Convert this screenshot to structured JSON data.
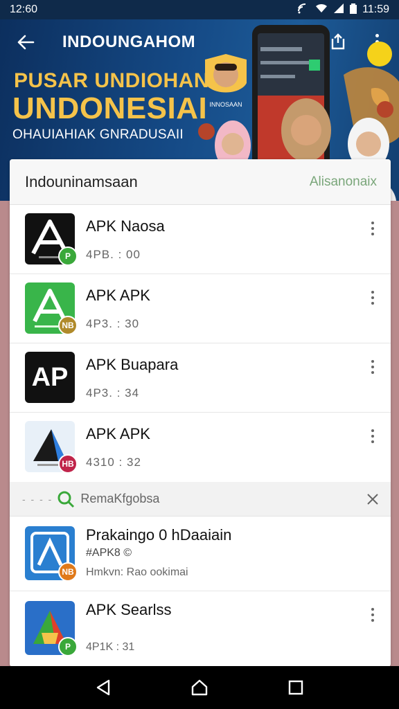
{
  "status_bar": {
    "time": "12:60",
    "battery": "11:59"
  },
  "app_bar": {
    "title": "INDOUNGAHOM"
  },
  "hero": {
    "line1": "PUSAR UNDIOHAN",
    "line2": "UNDONESIAI",
    "line3": "OHAUIAHIAK GNRADUSAII",
    "badge_text": "INNOSAAN"
  },
  "card": {
    "title": "Indouninamsaan",
    "action": "Alisanonaix"
  },
  "apps": [
    {
      "name": "APK Naosa",
      "sub": "4PB. : 00",
      "tile_text": "A",
      "badge": "P",
      "tile_bg": "#111111",
      "badge_bg": "#3aa83a"
    },
    {
      "name": "APK APK",
      "sub": "4P3. : 30",
      "tile_text": "A",
      "badge": "NB",
      "tile_bg": "#39b54a",
      "badge_bg": "#b08a2a"
    },
    {
      "name": "APK Buapara",
      "sub": "4P3. : 34",
      "tile_text": "AP",
      "badge": "",
      "tile_bg": "#111111",
      "badge_bg": ""
    },
    {
      "name": "APK APK",
      "sub": "4310 : 32",
      "tile_text": "A",
      "badge": "HB",
      "tile_bg": "#e8f0f8",
      "badge_bg": "#c0244a"
    }
  ],
  "section": {
    "label": "RemaKfgobsa"
  },
  "apps2": [
    {
      "name": "Prakaingo 0 hDaaiain",
      "sub1": "#APK8 ©",
      "sub2": "Hmkvn: Rao ookimai",
      "badge": "NB",
      "tile_bg": "#2a7fd0",
      "badge_bg": "#e07a1a"
    },
    {
      "name": "APK Searlss",
      "sub1": "",
      "sub2": "4P1K : 31",
      "badge": "P",
      "tile_bg": "#2a6fc8",
      "badge_bg": "#3aa83a"
    }
  ]
}
